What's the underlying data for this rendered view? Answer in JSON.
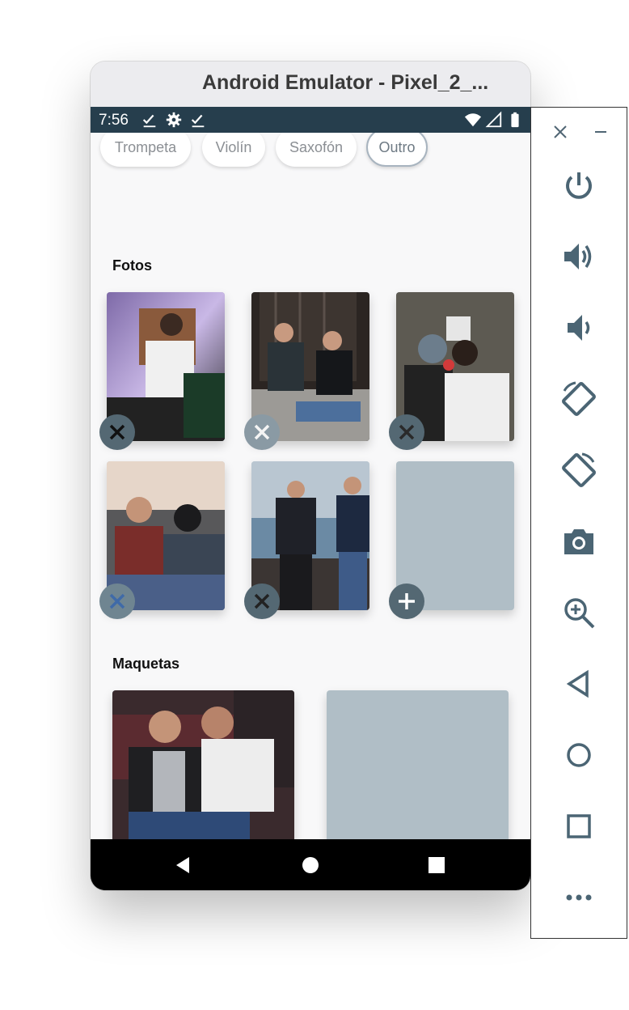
{
  "window": {
    "title": "Android Emulator - Pixel_2_..."
  },
  "status_bar": {
    "time": "7:56",
    "left_icons": [
      "check-icon",
      "gear-icon",
      "check-icon"
    ],
    "right_icons": [
      "wifi-icon",
      "signal-icon",
      "battery-icon"
    ]
  },
  "chips": [
    {
      "label": "Trompeta",
      "selected": false
    },
    {
      "label": "Violín",
      "selected": false
    },
    {
      "label": "Saxofón",
      "selected": false
    },
    {
      "label": "Outro",
      "selected": true
    }
  ],
  "fotos": {
    "title": "Fotos",
    "items": [
      {
        "has_photo": true,
        "action": "remove"
      },
      {
        "has_photo": true,
        "action": "remove"
      },
      {
        "has_photo": true,
        "action": "remove"
      },
      {
        "has_photo": true,
        "action": "remove"
      },
      {
        "has_photo": true,
        "action": "remove"
      },
      {
        "has_photo": false,
        "action": "add"
      }
    ]
  },
  "maquetas": {
    "title": "Maquetas",
    "items": [
      {
        "has_photo": true,
        "action": "remove"
      },
      {
        "has_photo": false,
        "action": "add"
      }
    ]
  },
  "nav_bar": [
    "back-icon",
    "home-icon",
    "recents-icon"
  ],
  "side_toolbar": {
    "top": [
      "close-icon",
      "minimize-icon"
    ],
    "buttons": [
      "power-icon",
      "volume-up-icon",
      "volume-down-icon",
      "rotate-left-icon",
      "rotate-right-icon",
      "camera-icon",
      "zoom-icon",
      "back-icon",
      "home-icon",
      "overview-icon",
      "more-icon"
    ]
  },
  "colors": {
    "status_bar": "#263e4d",
    "fab": "#546873",
    "placeholder": "#b0bec6",
    "screen_bg": "#f8f8f9"
  }
}
